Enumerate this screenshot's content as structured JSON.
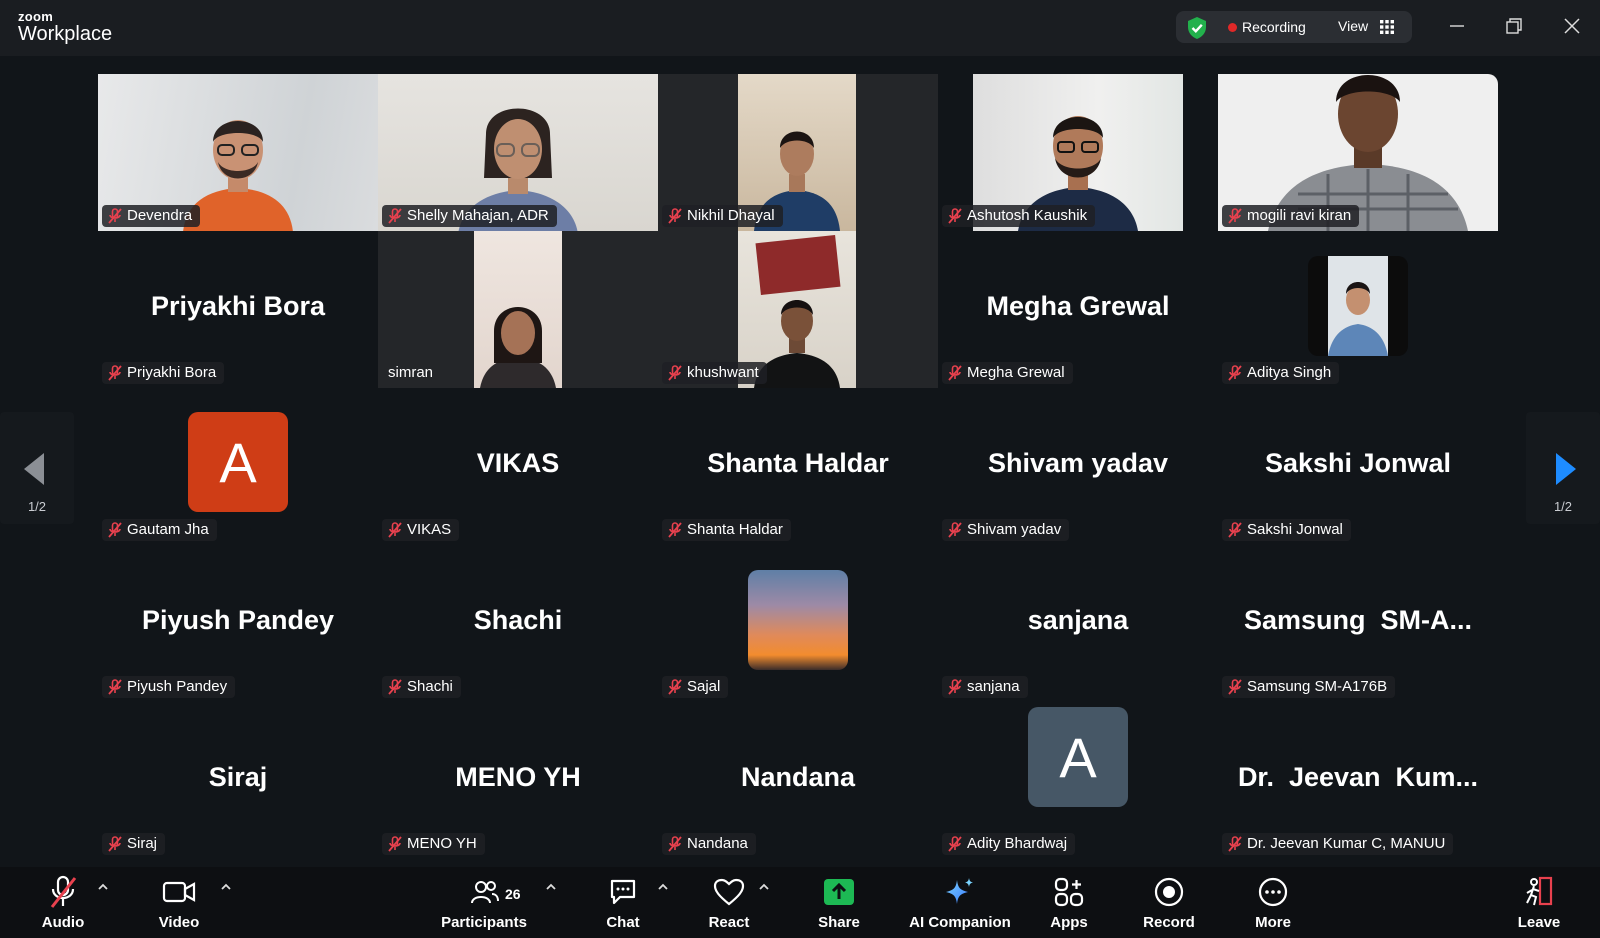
{
  "app": {
    "brand_top": "zoom",
    "brand_bottom": "Workplace"
  },
  "header": {
    "recording_label": "Recording",
    "view_label": "View"
  },
  "colors": {
    "active_speaker": "#2ed47a",
    "recording": "#e02828",
    "share": "#1db954",
    "avatar_orange": "#cf3d16",
    "avatar_slate": "#465766"
  },
  "participants": [
    {
      "name": "Devendra",
      "tag": "Devendra",
      "video": true,
      "active": true
    },
    {
      "name": "Shelly Mahajan, ADR",
      "tag": "Shelly Mahajan, ADR",
      "video": true
    },
    {
      "name": "Nikhil Dhayal",
      "tag": "Nikhil Dhayal",
      "video": true
    },
    {
      "name": "Ashutosh Kaushik",
      "tag": "Ashutosh Kaushik",
      "video": true
    },
    {
      "name": "mogili ravi kiran",
      "tag": "mogili ravi kiran",
      "video": true
    },
    {
      "name": "Priyakhi Bora",
      "tag": "Priyakhi Bora"
    },
    {
      "name": "simran",
      "tag": "simran",
      "video": true,
      "unmuted": true
    },
    {
      "name": "khushwant",
      "tag": "khushwant",
      "video": true
    },
    {
      "name": "Megha Grewal",
      "tag": "Megha Grewal"
    },
    {
      "name": "Aditya Singh",
      "tag": "Aditya Singh",
      "photo": true
    },
    {
      "name": "Gautam Jha",
      "tag": "Gautam Jha",
      "avatar": "A"
    },
    {
      "name": "VIKAS",
      "tag": "VIKAS"
    },
    {
      "name": "Shanta Haldar",
      "tag": "Shanta Haldar"
    },
    {
      "name": "Shivam yadav",
      "tag": "Shivam yadav"
    },
    {
      "name": "Sakshi Jonwal",
      "tag": "Sakshi Jonwal"
    },
    {
      "name": "Piyush Pandey",
      "tag": "Piyush Pandey"
    },
    {
      "name": "Shachi",
      "tag": "Shachi"
    },
    {
      "name": "Sajal",
      "tag": "Sajal",
      "photo": true
    },
    {
      "name": "sanjana",
      "tag": "sanjana"
    },
    {
      "name": "Samsung  SM-A...",
      "tag": "Samsung SM-A176B"
    },
    {
      "name": "Siraj",
      "tag": "Siraj"
    },
    {
      "name": "MENO YH",
      "tag": "MENO YH"
    },
    {
      "name": "Nandana",
      "tag": "Nandana"
    },
    {
      "name": "Adity Bhardwaj",
      "tag": "Adity Bhardwaj",
      "avatar": "A"
    },
    {
      "name": "Dr.  Jeevan  Kum...",
      "tag": "Dr. Jeevan Kumar C, MANUU"
    }
  ],
  "pagination": {
    "left": "1/2",
    "right": "1/2"
  },
  "toolbar": {
    "audio": "Audio",
    "video": "Video",
    "participants": "Participants",
    "participant_count": "26",
    "chat": "Chat",
    "react": "React",
    "share": "Share",
    "ai_companion": "AI Companion",
    "apps": "Apps",
    "record": "Record",
    "more": "More",
    "leave": "Leave"
  }
}
